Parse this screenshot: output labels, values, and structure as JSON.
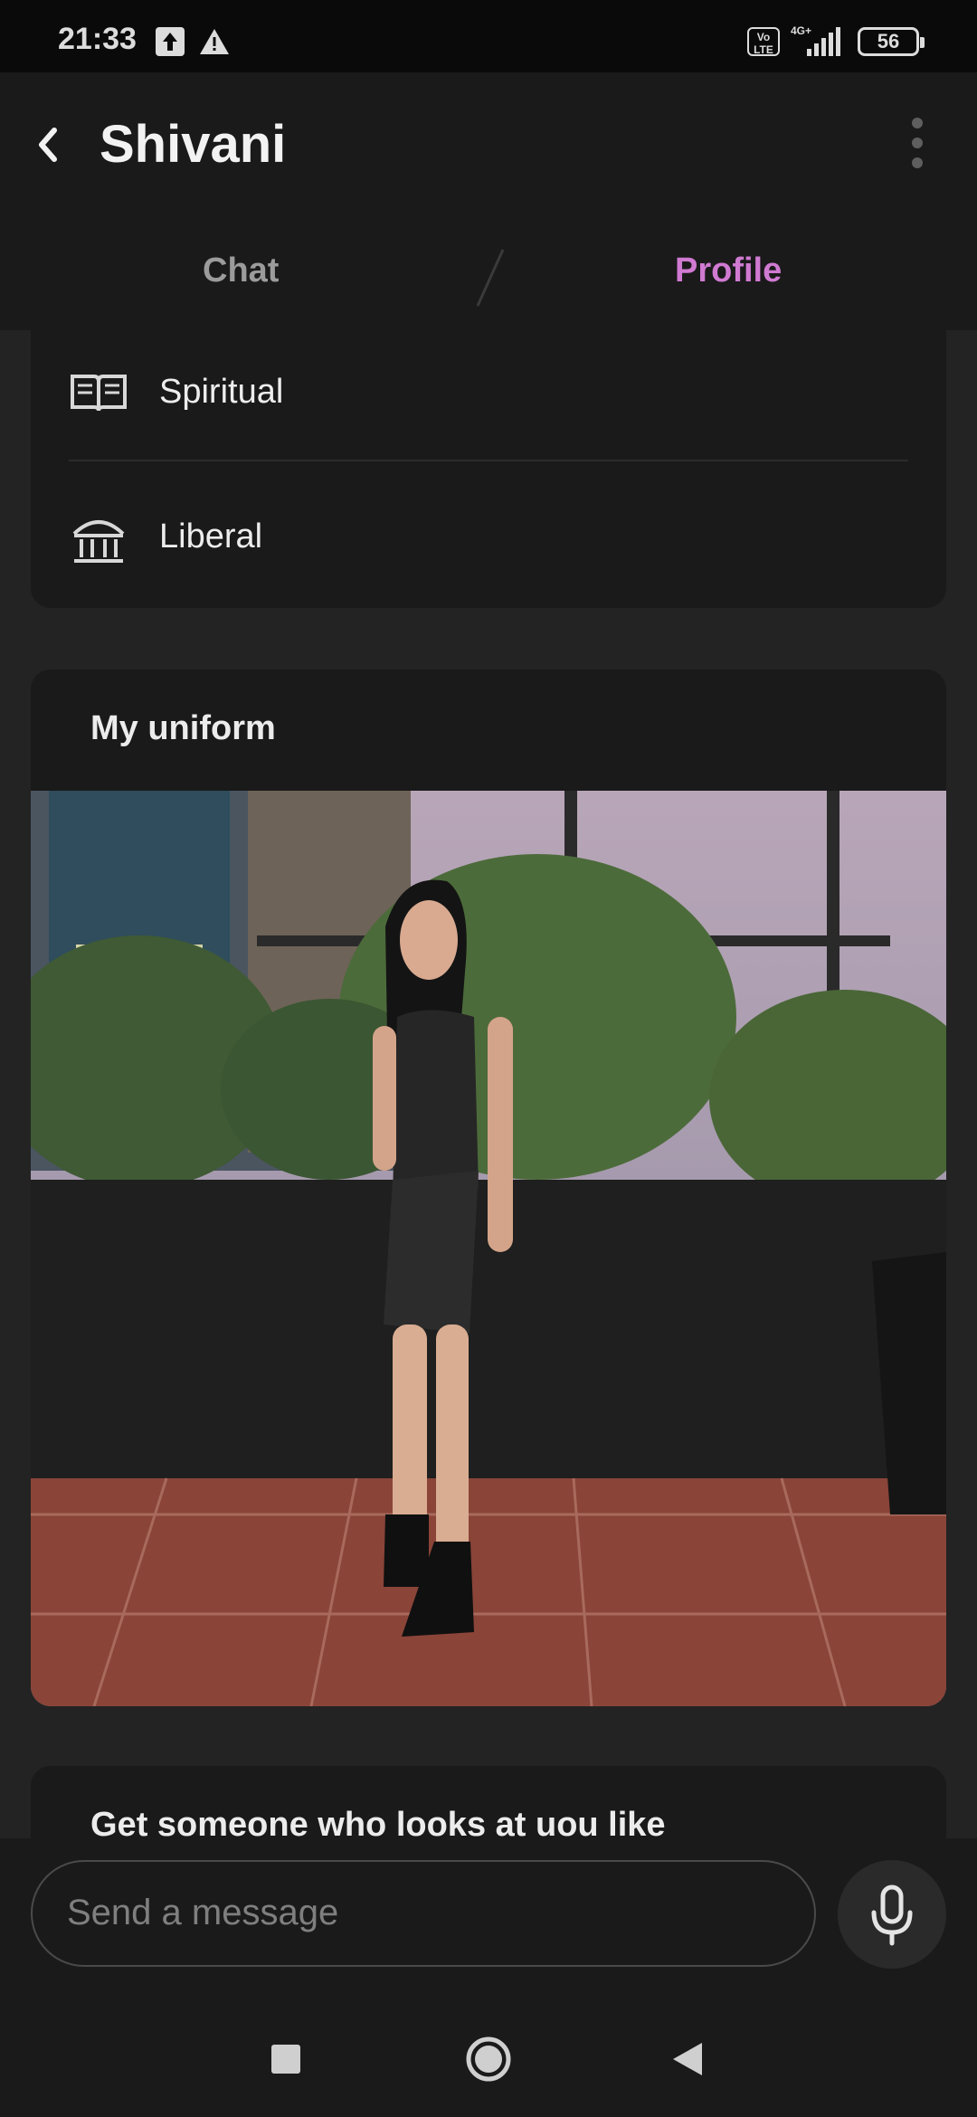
{
  "status_bar": {
    "time": "21:33",
    "volte": "Vo LTE",
    "network": "4G+",
    "battery": "56",
    "icons": [
      "upload-icon",
      "warning-icon",
      "signal-icon",
      "battery-icon"
    ]
  },
  "header": {
    "title": "Shivani",
    "tabs": [
      {
        "label": "Chat",
        "active": false
      },
      {
        "label": "Profile",
        "active": true
      }
    ],
    "accent_color": "#d07ad2"
  },
  "profile": {
    "info_rows": [
      {
        "label": "Spiritual",
        "icon": "book-icon"
      },
      {
        "label": "Liberal",
        "icon": "institution-icon"
      }
    ],
    "prompt_cards": [
      {
        "title": "My uniform"
      },
      {
        "title": "Get someone who looks at uou like"
      }
    ]
  },
  "composer": {
    "placeholder": "Send a message",
    "mic_icon": "microphone-icon"
  },
  "nav": {
    "icons": [
      "recents-icon",
      "home-icon",
      "back-icon"
    ]
  }
}
